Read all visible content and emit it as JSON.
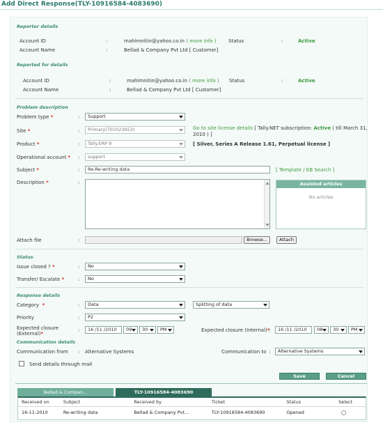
{
  "title": "Add Direct Response(TLY-10916584-4083690)",
  "reporter": {
    "heading": "Reporter details",
    "account_id_label": "Account ID",
    "account_id": "mahimnitin@yahoo.co.in",
    "more_info": "( more info )",
    "status_label": "Status",
    "status": "Active",
    "account_name_label": "Account Name",
    "account_name": "Bellad & Company Pvt Ltd [ Customer]"
  },
  "reported_for": {
    "heading": "Reported for details",
    "account_id_label": "Account ID",
    "account_id": "mahimnitin@yahoo.co.in",
    "more_info": "( more info )",
    "status_label": "Status",
    "status": "Active",
    "account_name_label": "Account Name",
    "account_name": "Bellad & Company Pvt Ltd [ Customer]"
  },
  "problem": {
    "heading": "Problem description",
    "problem_type_label": "Problem type",
    "problem_type": "Support",
    "site_label": "Site",
    "site": "Primary(701023653)",
    "site_link": "Go to site license details",
    "subscription_prefix": "[ Tally.NET subscription:",
    "subscription_status": "Active",
    "subscription_line1_end": "( till March 31,",
    "subscription_line2": "2010 ) ]",
    "product_label": "Product",
    "product": "Tally.ERP 9",
    "product_note": "[ Silver, Series A Release 1.61, Perpetual license ]",
    "operational_account_label": "Operational account",
    "operational_account": "support",
    "subject_label": "Subject",
    "subject": "Re:Re-writing data",
    "template_link": "Template",
    "kb_link": "KB Search",
    "description_label": "Description",
    "assisted_heading": "Assisted articles",
    "no_articles": "No articles",
    "attach_label": "Attach file",
    "browse": "Browse...",
    "attach_button": "Attach"
  },
  "status_sec": {
    "heading": "Status",
    "issue_closed_label": "Issue closed ?",
    "issue_closed": "No",
    "transfer_label": "Transfer/ Escalate",
    "transfer": "No"
  },
  "response": {
    "heading": "Response details",
    "category_label": "Category",
    "category": "Data",
    "subcategory": "Splitting of data",
    "priority_label": "Priority",
    "priority": "P2",
    "ext_label_1": "Expected closure",
    "ext_label_2": "(External)",
    "ext_date": "16 /11 /2010",
    "ext_hour": "09",
    "ext_min": "30",
    "ext_ampm": "PM",
    "int_label": "Expected closure (Internal)",
    "int_date": "16 /11 /2010",
    "int_hour": "08",
    "int_min": "30",
    "int_ampm": "PM"
  },
  "communication": {
    "heading": "Communication details",
    "from_label": "Communication from",
    "from": "Alternative Systems",
    "to_label": "Communication to",
    "to": "Alternative Systems",
    "send_mail": "Send details through mail"
  },
  "actions": {
    "save": "Save",
    "cancel": "Cancel"
  },
  "colon": ":",
  "tabs": [
    {
      "label": "Bellad & Compan..."
    },
    {
      "label": "TLY-10916584-4083690"
    }
  ],
  "table": {
    "headers": [
      "Received on",
      "Subject",
      "Received by",
      "Ticket",
      "Status",
      "Select"
    ],
    "rows": [
      {
        "received_on": "16-11-2010",
        "subject": "Re-writing data",
        "received_by": "Bellad & Company Pvt...",
        "ticket": "TLY-10916584-4083690",
        "status": "Opened"
      }
    ]
  }
}
